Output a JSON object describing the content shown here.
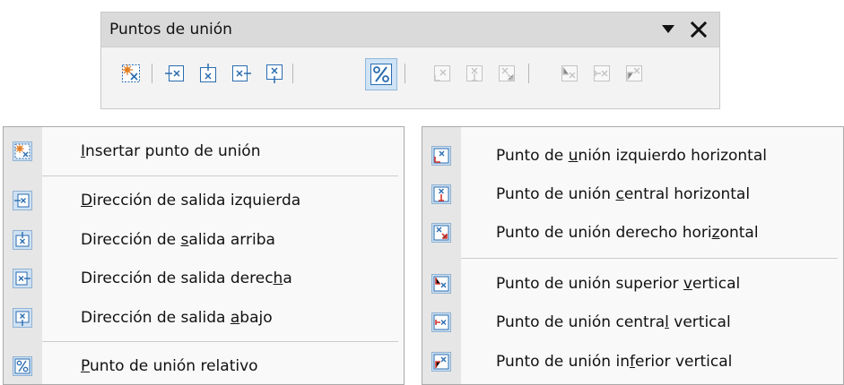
{
  "toolbar": {
    "title": "Puntos de unión",
    "menu_icon": "triangle-down-icon",
    "close_icon": "close-icon",
    "buttons": [
      {
        "icon": "insert-glue-point-icon",
        "active": false,
        "enabled": true
      },
      {
        "icon": "exit-left-icon",
        "active": false,
        "enabled": true
      },
      {
        "icon": "exit-top-icon",
        "active": false,
        "enabled": true
      },
      {
        "icon": "exit-right-icon",
        "active": false,
        "enabled": true
      },
      {
        "icon": "exit-bottom-icon",
        "active": false,
        "enabled": true
      },
      {
        "icon": "glue-relative-icon",
        "active": true,
        "enabled": true
      },
      {
        "icon": "glue-horizontal-left-icon",
        "active": false,
        "enabled": false
      },
      {
        "icon": "glue-horizontal-center-icon",
        "active": false,
        "enabled": false
      },
      {
        "icon": "glue-horizontal-right-icon",
        "active": false,
        "enabled": false
      },
      {
        "icon": "glue-vertical-top-icon",
        "active": false,
        "enabled": false
      },
      {
        "icon": "glue-vertical-center-icon",
        "active": false,
        "enabled": false
      },
      {
        "icon": "glue-vertical-bottom-icon",
        "active": false,
        "enabled": false
      }
    ]
  },
  "menu_left": {
    "items": [
      {
        "pre": "",
        "key": "I",
        "post": "nsertar punto de unión",
        "icon": "insert-glue-point-icon"
      },
      {
        "pre": "",
        "key": "D",
        "post": "irección de salida izquierda",
        "icon": "exit-left-icon"
      },
      {
        "pre": "Dirección de ",
        "key": "s",
        "post": "alida arriba",
        "icon": "exit-top-icon"
      },
      {
        "pre": "Dirección de salida derec",
        "key": "h",
        "post": "a",
        "icon": "exit-right-icon"
      },
      {
        "pre": "Dirección de salida ",
        "key": "a",
        "post": "bajo",
        "icon": "exit-bottom-icon"
      },
      {
        "pre": "",
        "key": "P",
        "post": "unto de unión relativo",
        "icon": "glue-relative-icon"
      }
    ]
  },
  "menu_right": {
    "items": [
      {
        "pre": "Punto de ",
        "key": "u",
        "post": "nión izquierdo horizontal",
        "icon": "glue-horizontal-left-icon"
      },
      {
        "pre": "Punto de unión ",
        "key": "c",
        "post": "entral horizontal",
        "icon": "glue-horizontal-center-icon"
      },
      {
        "pre": "Punto de unión derecho hori",
        "key": "z",
        "post": "ontal",
        "icon": "glue-horizontal-right-icon"
      },
      {
        "pre": "Punto de unión superior ",
        "key": "v",
        "post": "ertical",
        "icon": "glue-vertical-top-icon"
      },
      {
        "pre": "Punto de unión centra",
        "key": "l",
        "post": " vertical",
        "icon": "glue-vertical-center-icon"
      },
      {
        "pre": "Punto de unión in",
        "key": "f",
        "post": "erior vertical",
        "icon": "glue-vertical-bottom-icon"
      }
    ]
  },
  "colors": {
    "accent_red": "#d9372f",
    "icon_blue": "#2a6cb0",
    "active_bg": "#cfe3f5"
  }
}
